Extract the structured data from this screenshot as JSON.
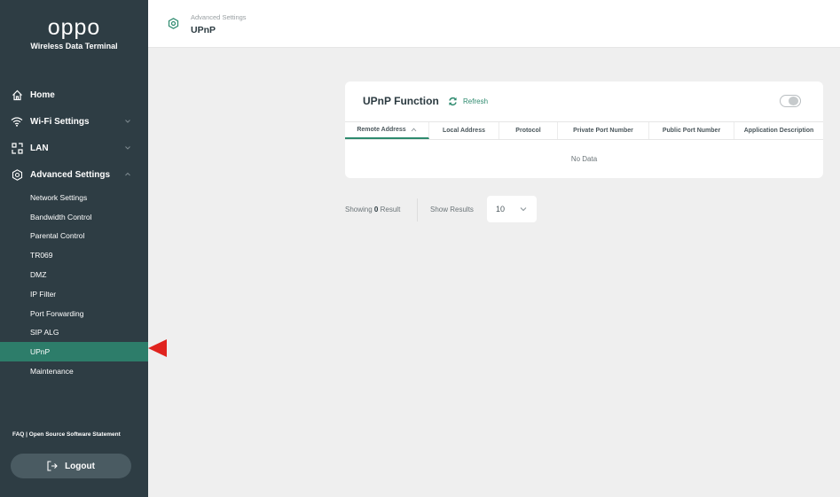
{
  "brand": {
    "logo": "oppo",
    "subtitle": "Wireless Data Terminal"
  },
  "sidebar": {
    "items": [
      {
        "label": "Home",
        "icon": "home-icon"
      },
      {
        "label": "Wi-Fi Settings",
        "icon": "wifi-icon"
      },
      {
        "label": "LAN",
        "icon": "lan-icon"
      },
      {
        "label": "Advanced Settings",
        "icon": "gear-icon"
      }
    ],
    "sub_items": [
      "Network Settings",
      "Bandwidth Control",
      "Parental Control",
      "TR069",
      "DMZ",
      "IP Filter",
      "Port Forwarding",
      "SIP ALG",
      "UPnP",
      "Maintenance"
    ],
    "active_sub_item": "UPnP",
    "footer": "FAQ | Open Source Software Statement",
    "logout_label": "Logout"
  },
  "header": {
    "breadcrumb_parent": "Advanced Settings",
    "title": "UPnP"
  },
  "card": {
    "title": "UPnP Function",
    "refresh_label": "Refresh",
    "toggle_on": false,
    "columns": [
      "Remote Address",
      "Local Address",
      "Protocol",
      "Private Port Number",
      "Public Port Number",
      "Application Description"
    ],
    "empty_text": "No Data"
  },
  "pagination": {
    "showing_prefix": "Showing",
    "result_count": "0",
    "showing_suffix": "Result",
    "show_results_label": "Show Results",
    "page_size": "10"
  },
  "colors": {
    "sidebar_bg": "#2e3d44",
    "accent": "#2d8a6e",
    "active_item": "#2d7d6a",
    "pointer": "#e0231e"
  }
}
